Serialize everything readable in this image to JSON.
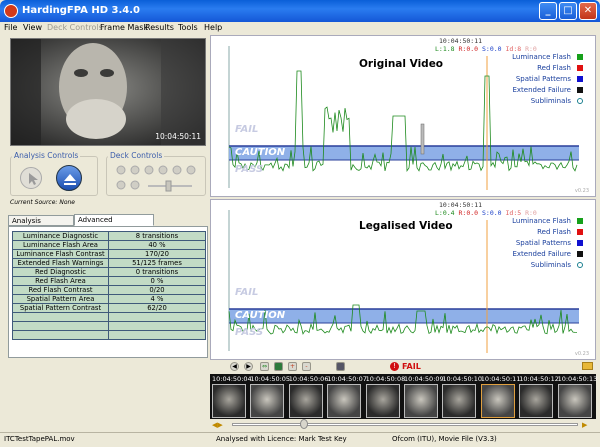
{
  "window": {
    "title": "HardingFPA HD 3.4.0"
  },
  "menu": [
    {
      "label": "File",
      "enabled": true
    },
    {
      "label": "View",
      "enabled": true
    },
    {
      "label": "Deck Controls",
      "enabled": false
    },
    {
      "label": "Frame Mask",
      "enabled": true
    },
    {
      "label": "Results",
      "enabled": true
    },
    {
      "label": "Tools",
      "enabled": true
    },
    {
      "label": "Help",
      "enabled": true
    }
  ],
  "video": {
    "timecode": "10:04:50:11"
  },
  "analysis_controls": {
    "label": "Analysis Controls"
  },
  "deck_controls": {
    "label": "Deck Controls"
  },
  "current_source": "Current Source: None",
  "tabs": [
    {
      "label": "Analysis Summary",
      "active": false
    },
    {
      "label": "Advanced Information",
      "active": true
    }
  ],
  "summary_rows": [
    {
      "label": "Luminance Diagnostic",
      "value": "8 transitions"
    },
    {
      "label": "Luminance Flash Area",
      "value": "40 %"
    },
    {
      "label": "Luminance Flash Contrast",
      "value": "170/20"
    },
    {
      "label": "Extended Flash Warnings",
      "value": "51/125 frames"
    },
    {
      "label": "Red Diagnostic",
      "value": "0 transitions"
    },
    {
      "label": "Red Flash Area",
      "value": "0 %"
    },
    {
      "label": "Red Flash Contrast",
      "value": "0/20"
    },
    {
      "label": "Spatial Pattern Area",
      "value": "4 %"
    },
    {
      "label": "Spatial Pattern Contrast",
      "value": "62/20"
    },
    {
      "label": "",
      "value": ""
    },
    {
      "label": "",
      "value": ""
    },
    {
      "label": "",
      "value": ""
    }
  ],
  "graphs": [
    {
      "title": "Original Video",
      "timecode": "10:04:50:11",
      "counts": [
        {
          "text": "L:1.8",
          "color": "#1d8a1d"
        },
        {
          "text": "R:0.0",
          "color": "#d02020"
        },
        {
          "text": "S:0.0",
          "color": "#1a3fc8"
        },
        {
          "text": "Id:8",
          "color": "#e06060"
        },
        {
          "text": "R:0",
          "color": "#e0a0a0"
        }
      ],
      "zones": [
        "FAIL",
        "CAUTION",
        "PASS"
      ],
      "corner": "v0.23"
    },
    {
      "title": "Legalised Video",
      "timecode": "10:04:50:11",
      "counts": [
        {
          "text": "L:0.4",
          "color": "#1d8a1d"
        },
        {
          "text": "R:0.0",
          "color": "#d02020"
        },
        {
          "text": "S:0.0",
          "color": "#1a3fc8"
        },
        {
          "text": "Id:5",
          "color": "#e06060"
        },
        {
          "text": "R:0",
          "color": "#e0a0a0"
        }
      ],
      "zones": [
        "FAIL",
        "CAUTION",
        "PASS"
      ],
      "corner": "v0.23"
    }
  ],
  "legend": [
    {
      "label": "Luminance Flash",
      "color": "#16a01a"
    },
    {
      "label": "Red Flash",
      "color": "#e01010"
    },
    {
      "label": "Spatial Patterns",
      "color": "#1010d0"
    },
    {
      "label": "Extended Failure",
      "color": "#111111"
    },
    {
      "label": "Subliminals",
      "color": "#1a7f8f"
    }
  ],
  "result": {
    "label": "FAIL",
    "color": "#d01010"
  },
  "filmstrip": [
    "10:04:50:04",
    "10:04:50:05",
    "10:04:50:06",
    "10:04:50:07",
    "10:04:50:08",
    "10:04:50:09",
    "10:04:50:10",
    "10:04:50:11",
    "10:04:50:12",
    "10:04:50:13"
  ],
  "status": {
    "file": "ITCTestTapePAL.mov",
    "licence": "Analysed with Licence: Mark Test Key",
    "standard": "Ofcom (ITU), Movie File (V3.3)"
  }
}
